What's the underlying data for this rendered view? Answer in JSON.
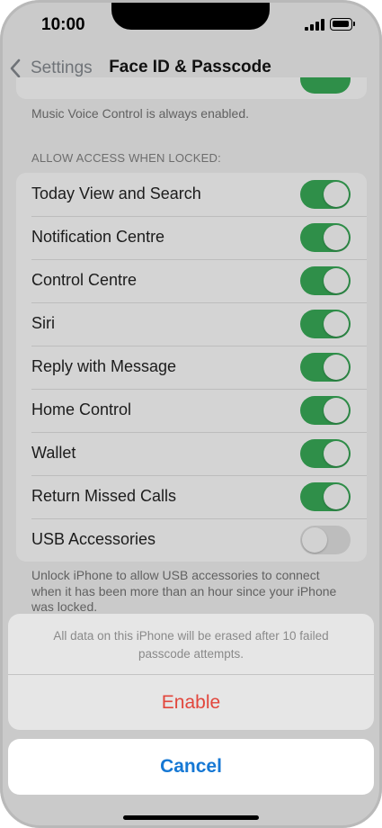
{
  "status_bar": {
    "time": "10:00"
  },
  "nav": {
    "back_label": "Settings",
    "title": "Face ID & Passcode"
  },
  "previous_section": {
    "footnote": "Music Voice Control is always enabled.",
    "toggle_on": true
  },
  "allow_access": {
    "header": "ALLOW ACCESS WHEN LOCKED:",
    "items": [
      {
        "label": "Today View and Search",
        "on": true
      },
      {
        "label": "Notification Centre",
        "on": true
      },
      {
        "label": "Control Centre",
        "on": true
      },
      {
        "label": "Siri",
        "on": true
      },
      {
        "label": "Reply with Message",
        "on": true
      },
      {
        "label": "Home Control",
        "on": true
      },
      {
        "label": "Wallet",
        "on": true
      },
      {
        "label": "Return Missed Calls",
        "on": true
      },
      {
        "label": "USB Accessories",
        "on": false
      }
    ],
    "footnote": "Unlock iPhone to allow USB accessories to connect when it has been more than an hour since your iPhone was locked."
  },
  "action_sheet": {
    "message": "All data on this iPhone will be erased after 10 failed passcode attempts.",
    "enable_label": "Enable",
    "cancel_label": "Cancel"
  },
  "colors": {
    "toggle_on": "#2f8f49",
    "destructive": "#e2463c",
    "accent": "#1678d4"
  }
}
